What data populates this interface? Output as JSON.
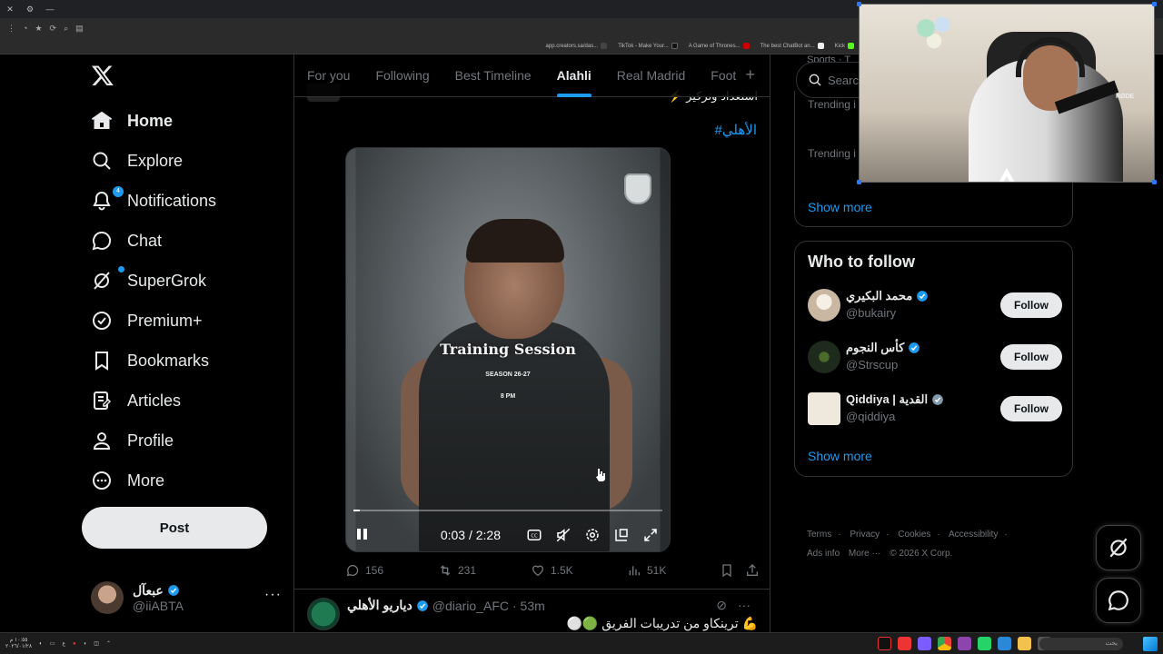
{
  "browser": {
    "bookmarks": [
      {
        "label": "app.creators.sa/das...",
        "color": "#444444"
      },
      {
        "label": "TikTok - Make Your...",
        "color": "#111111"
      },
      {
        "label": "A Game of Thrones...",
        "color": "#111111"
      },
      {
        "label": "The best ChatBot an...",
        "color": "#ff0033"
      },
      {
        "label": "Kick",
        "color": "#53fc18"
      }
    ]
  },
  "nav": {
    "items": [
      {
        "label": "Home",
        "icon": "home-icon",
        "active": true
      },
      {
        "label": "Explore",
        "icon": "search-icon"
      },
      {
        "label": "Notifications",
        "icon": "bell-icon",
        "badge": "4"
      },
      {
        "label": "Chat",
        "icon": "chat-icon"
      },
      {
        "label": "SuperGrok",
        "icon": "grok-icon"
      },
      {
        "label": "Premium+",
        "icon": "verified-icon"
      },
      {
        "label": "Bookmarks",
        "icon": "bookmark-icon"
      },
      {
        "label": "Articles",
        "icon": "article-icon"
      },
      {
        "label": "Profile",
        "icon": "profile-icon"
      },
      {
        "label": "More",
        "icon": "more-icon"
      }
    ],
    "post_label": "Post",
    "account": {
      "name": "عبعآل",
      "handle": "@iiABTA"
    }
  },
  "tabs": [
    "For you",
    "Following",
    "Best Timeline",
    "Alahli",
    "Real Madrid",
    "Foot"
  ],
  "active_tab": "Alahli",
  "post": {
    "partial_text": "استعداد وتركيز ⚡",
    "hashtag": "#الأهلي",
    "video": {
      "title": "Training Session",
      "season": "SEASON 26-27",
      "time": "8 PM",
      "timecode": "0:03 / 2:28",
      "progress": 0.02
    },
    "stats": {
      "replies": "156",
      "reposts": "231",
      "likes": "1.5K",
      "views": "51K"
    }
  },
  "next_post": {
    "name": "دياريو الأهلي",
    "handle": "@diario_AFC",
    "time": "· 53m",
    "text": "💪 ترينكاو من تدريبات الفريق 🟢⚪"
  },
  "right": {
    "search_placeholder": "Search",
    "sports_label": "Sports · T",
    "trending_1": "Trending i",
    "trending_2": "Trending i",
    "show_more": "Show more",
    "who_to_follow_title": "Who to follow",
    "follow_label": "Follow",
    "suggestions": [
      {
        "name": "محمد البكيري",
        "handle": "@bukairy",
        "avatar_color": "#d8c9b8"
      },
      {
        "name": "كأس النجوم",
        "handle": "@Strscup",
        "avatar_color": "#1d2a1c"
      },
      {
        "name": "Qiddiya | القدية",
        "handle": "@qiddiya",
        "avatar_color": "#efe9dd"
      }
    ],
    "show_more_2": "Show more",
    "footer": [
      "Terms",
      "Privacy",
      "Cookies",
      "Accessibility",
      "Ads info",
      "More ···",
      "© 2026 X Corp."
    ]
  },
  "webcam": {
    "mic_brand": "RØDE"
  },
  "taskbar": {
    "clock": "١٠:٥٥ م",
    "date": "٢٠٢٦/٠١/٢٨",
    "lang": "ع",
    "search": "بحث"
  }
}
